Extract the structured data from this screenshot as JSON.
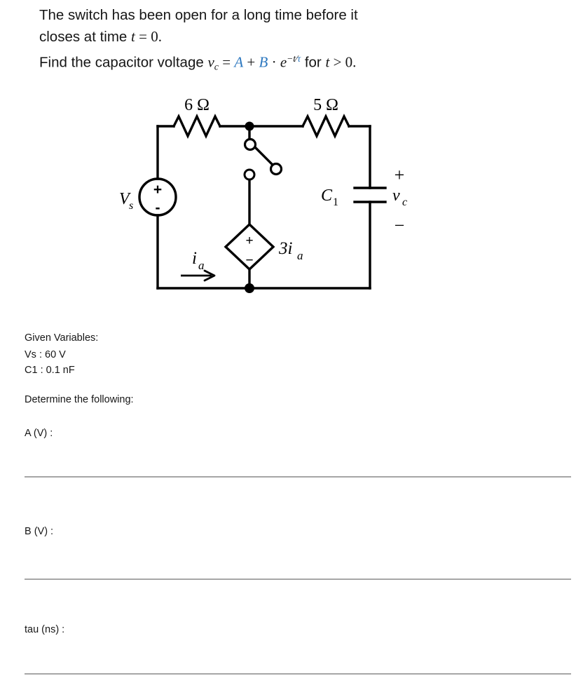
{
  "problem": {
    "line1": "The switch has been open for a long time before it",
    "line2_prefix": "closes at time ",
    "line2_math_t": "t",
    "line2_math_eq": " = 0.",
    "line3_prefix": "Find the capacitor voltage ",
    "line3_vc": "v",
    "line3_vc_sub": "c",
    "line3_eq": " = ",
    "line3_A": "A",
    "line3_plus": " + ",
    "line3_B": "B",
    "line3_dot": " · ",
    "line3_e": "e",
    "line3_exp_minus_t": "−t",
    "line3_exp_slash": "⁄",
    "line3_exp_tau": "τ",
    "line3_suffix_for": " for ",
    "line3_suffix_t": "t",
    "line3_suffix_cond": " > 0."
  },
  "circuit": {
    "resistor_left_label": "6 Ω",
    "resistor_right_label": "5 Ω",
    "source_label": "V",
    "source_label_sub": "s",
    "source_plus": "+",
    "source_minus": "-",
    "capacitor_label": "C",
    "capacitor_label_sub": "1",
    "capacitor_voltage": "v",
    "capacitor_voltage_sub": "c",
    "capacitor_plus": "+",
    "capacitor_minus": "−",
    "dep_source_plus": "+",
    "dep_source_minus": "−",
    "dep_source_label": "3i",
    "dep_source_label_sub": "a",
    "current_label": "i",
    "current_label_sub": "a"
  },
  "given": {
    "heading": "Given Variables:",
    "items": [
      "Vs : 60 V",
      "C1 : 0.1 nF"
    ],
    "determine": "Determine the following:"
  },
  "answers": [
    {
      "label": "A (V) :"
    },
    {
      "label": "B (V) :"
    },
    {
      "label": "tau (ns) :"
    }
  ],
  "colors": {
    "accent_blue": "#2b77bf",
    "rule_gray": "#a6a6a6",
    "text_black": "#161616",
    "circuit_black": "#000000"
  }
}
